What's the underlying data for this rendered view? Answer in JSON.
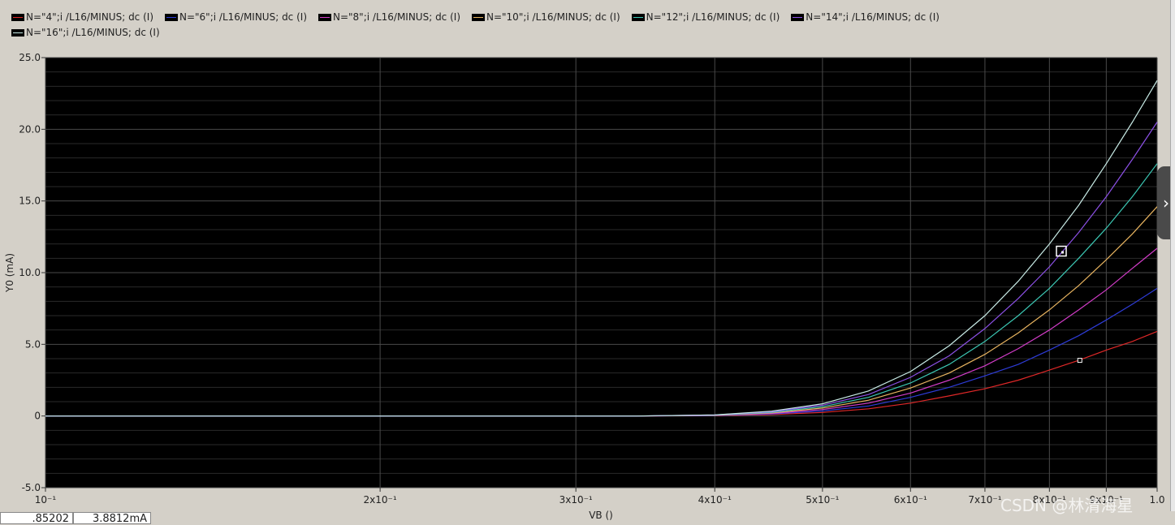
{
  "legend": [
    {
      "label": "N=\"4\";i /L16/MINUS; dc (I)",
      "color": "#e02828"
    },
    {
      "label": "N=\"6\";i /L16/MINUS; dc (I)",
      "color": "#2e3cd8"
    },
    {
      "label": "N=\"8\";i /L16/MINUS; dc (I)",
      "color": "#d23cc8"
    },
    {
      "label": "N=\"10\";i /L16/MINUS; dc (I)",
      "color": "#e8b460"
    },
    {
      "label": "N=\"12\";i /L16/MINUS; dc (I)",
      "color": "#3cc8b4"
    },
    {
      "label": "N=\"14\";i /L16/MINUS; dc (I)",
      "color": "#8c50e6"
    },
    {
      "label": "N=\"16\";i /L16/MINUS; dc (I)",
      "color": "#c8ebe6"
    }
  ],
  "cursor": {
    "x_value": ".85202",
    "y_value": "3.8812mA"
  },
  "watermark": "CSDN @林清海星",
  "side_tab_glyph": "›",
  "chart_data": {
    "type": "line",
    "xlabel": "VB ()",
    "ylabel": "Y0 (mA)",
    "x_scale": "log",
    "xlim": [
      0.1,
      1.0
    ],
    "ylim": [
      -5,
      25
    ],
    "grid": true,
    "x_ticks": [
      {
        "value": 0.1,
        "label": "10⁻¹"
      },
      {
        "value": 0.2,
        "label": "2x10⁻¹"
      },
      {
        "value": 0.3,
        "label": "3x10⁻¹"
      },
      {
        "value": 0.4,
        "label": "4x10⁻¹"
      },
      {
        "value": 0.5,
        "label": "5x10⁻¹"
      },
      {
        "value": 0.6,
        "label": "6x10⁻¹"
      },
      {
        "value": 0.7,
        "label": "7x10⁻¹"
      },
      {
        "value": 0.8,
        "label": "8x10⁻¹"
      },
      {
        "value": 0.9,
        "label": "9x10⁻¹"
      },
      {
        "value": 1.0,
        "label": "1.0"
      }
    ],
    "y_ticks": [
      {
        "value": 25,
        "label": "25.0"
      },
      {
        "value": 20,
        "label": "20.0"
      },
      {
        "value": 15,
        "label": "15.0"
      },
      {
        "value": 10,
        "label": "10.0"
      },
      {
        "value": 5,
        "label": "5.0"
      },
      {
        "value": 0,
        "label": "0"
      },
      {
        "value": -5,
        "label": "-5.0"
      }
    ],
    "x": [
      0.1,
      0.34,
      0.4,
      0.45,
      0.5,
      0.55,
      0.6,
      0.65,
      0.7,
      0.75,
      0.8,
      0.85,
      0.9,
      0.95,
      1.0
    ],
    "series": [
      {
        "name": "N=\"4\";i /L16/MINUS; dc (I)",
        "values": [
          0,
          0,
          0.02,
          0.1,
          0.25,
          0.5,
          0.9,
          1.4,
          1.9,
          2.5,
          3.2,
          3.88,
          4.6,
          5.2,
          5.9
        ]
      },
      {
        "name": "N=\"6\";i /L16/MINUS; dc (I)",
        "values": [
          0,
          0,
          0.03,
          0.14,
          0.35,
          0.7,
          1.3,
          2.0,
          2.8,
          3.6,
          4.6,
          5.6,
          6.7,
          7.8,
          8.9
        ]
      },
      {
        "name": "N=\"8\";i /L16/MINUS; dc (I)",
        "values": [
          0,
          0,
          0.04,
          0.18,
          0.45,
          0.9,
          1.6,
          2.5,
          3.5,
          4.7,
          6.0,
          7.4,
          8.8,
          10.3,
          11.7
        ]
      },
      {
        "name": "N=\"10\";i /L16/MINUS; dc (I)",
        "values": [
          0,
          0,
          0.05,
          0.22,
          0.55,
          1.1,
          1.95,
          3.0,
          4.3,
          5.8,
          7.4,
          9.1,
          10.9,
          12.7,
          14.6
        ]
      },
      {
        "name": "N=\"12\";i /L16/MINUS; dc (I)",
        "values": [
          0,
          0,
          0.06,
          0.26,
          0.65,
          1.3,
          2.3,
          3.6,
          5.2,
          7.0,
          8.9,
          11.0,
          13.1,
          15.3,
          17.6
        ]
      },
      {
        "name": "N=\"14\";i /L16/MINUS; dc (I)",
        "values": [
          0,
          0,
          0.07,
          0.3,
          0.75,
          1.5,
          2.7,
          4.2,
          6.1,
          8.2,
          10.4,
          12.8,
          15.3,
          17.9,
          20.5
        ]
      },
      {
        "name": "N=\"16\";i /L16/MINUS; dc (I)",
        "values": [
          0,
          0,
          0.08,
          0.34,
          0.85,
          1.75,
          3.1,
          4.9,
          7.0,
          9.4,
          12.0,
          14.7,
          17.6,
          20.5,
          23.4
        ]
      }
    ],
    "markers": [
      {
        "x": 0.85202,
        "y": 3.8812,
        "series": "N=\"4\";i /L16/MINUS; dc (I)",
        "style": "small-square"
      },
      {
        "x": 0.82,
        "y": 11.5,
        "series": "N=\"16\";i /L16/MINUS; dc (I)",
        "style": "large-square"
      }
    ]
  }
}
